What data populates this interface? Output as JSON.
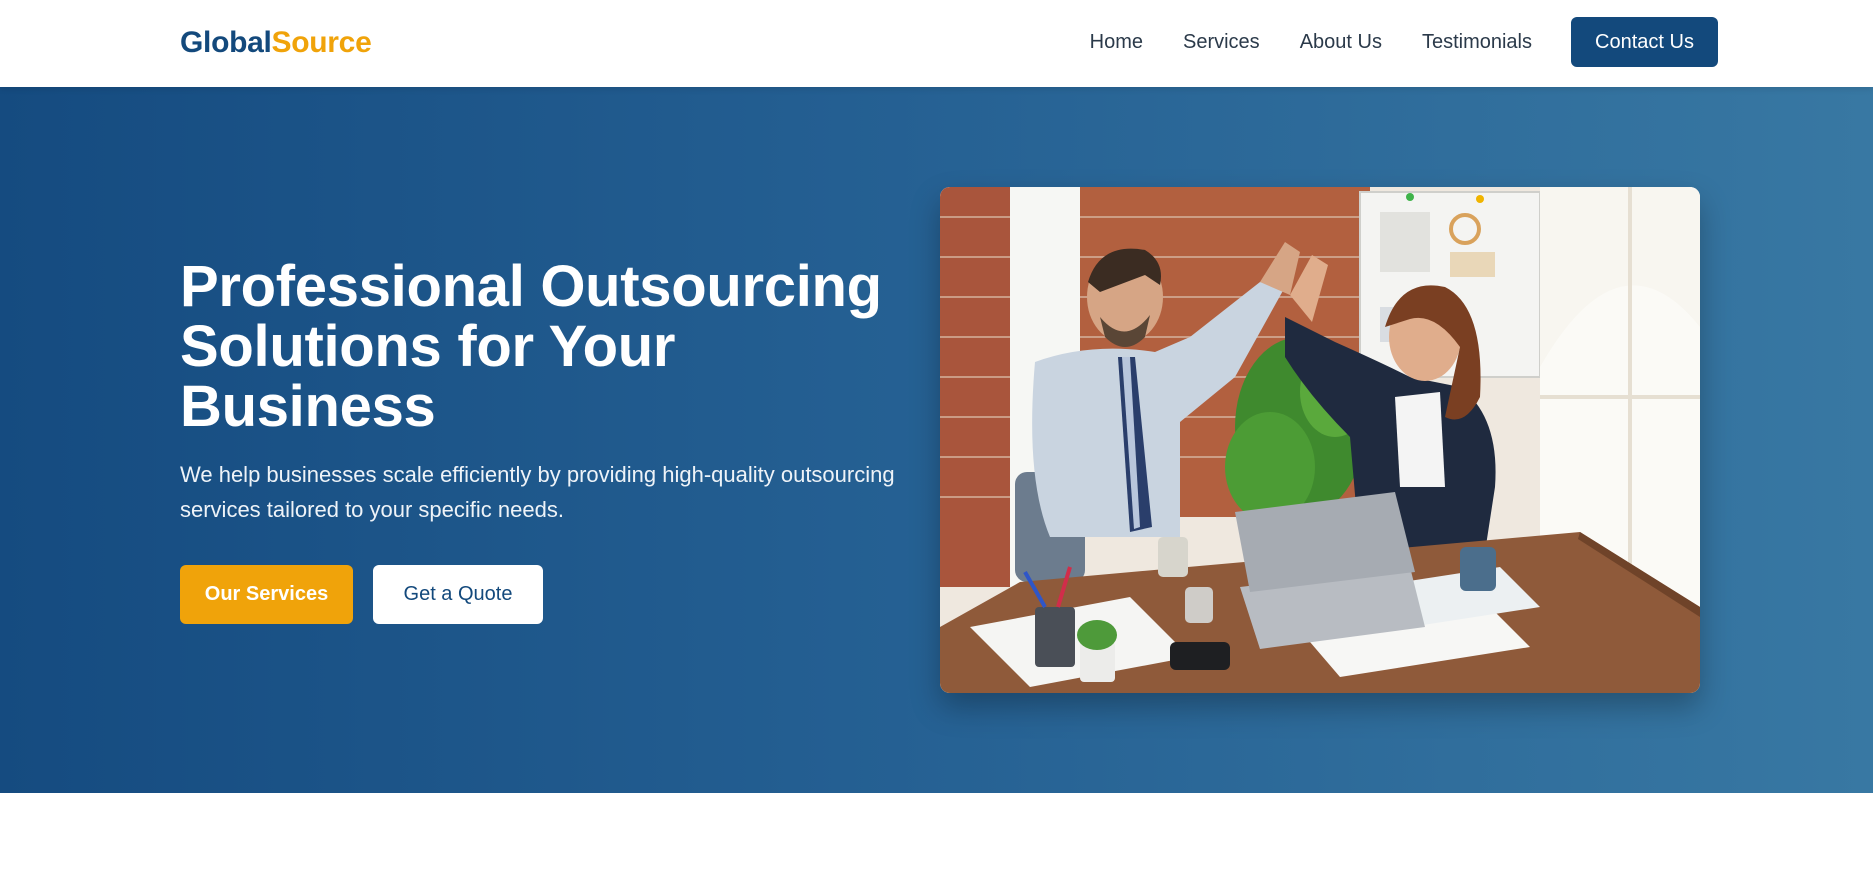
{
  "brand": {
    "logo_part1": "Global",
    "logo_part2": "Source",
    "primary_color": "#13497c",
    "accent_color": "#f0a30a"
  },
  "nav": {
    "items": [
      {
        "label": "Home"
      },
      {
        "label": "Services"
      },
      {
        "label": "About Us"
      },
      {
        "label": "Testimonials"
      }
    ],
    "cta_label": "Contact Us"
  },
  "hero": {
    "title": "Professional Outsourcing Solutions for Your Business",
    "subtitle": "We help businesses scale efficiently by providing high-quality outsourcing services tailored to your specific needs.",
    "primary_button": "Our Services",
    "secondary_button": "Get a Quote",
    "image_alt": "business-people-high-five-image",
    "gradient_start": "#154b80",
    "gradient_end": "#3878a3"
  }
}
